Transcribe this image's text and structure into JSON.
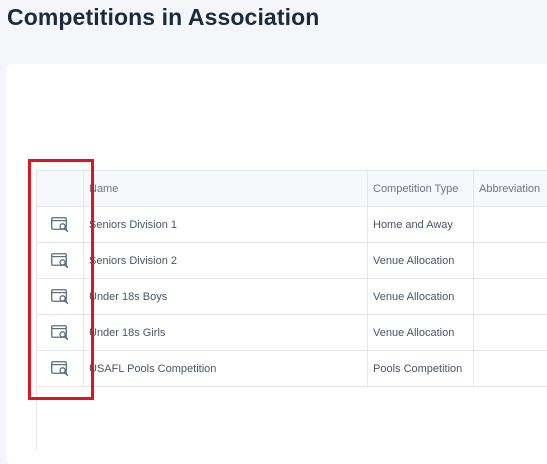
{
  "page": {
    "title": "Competitions in Association"
  },
  "table": {
    "columns": [
      "",
      "Name",
      "Competition Type",
      "Abbreviation"
    ],
    "rows": [
      {
        "icon": "view-details-icon",
        "name": "Seniors Division 1",
        "type": "Home and Away",
        "abbreviation": ""
      },
      {
        "icon": "view-details-icon",
        "name": "Seniors Division 2",
        "type": "Venue Allocation",
        "abbreviation": ""
      },
      {
        "icon": "view-details-icon",
        "name": "Under 18s Boys",
        "type": "Venue Allocation",
        "abbreviation": ""
      },
      {
        "icon": "view-details-icon",
        "name": "Under 18s Girls",
        "type": "Venue Allocation",
        "abbreviation": ""
      },
      {
        "icon": "view-details-icon",
        "name": "USAFL Pools Competition",
        "type": "Pools Competition",
        "abbreviation": ""
      }
    ]
  },
  "colors": {
    "highlight": "#e0141e",
    "icon": "#5b6b80",
    "title": "#1c2a3d"
  }
}
